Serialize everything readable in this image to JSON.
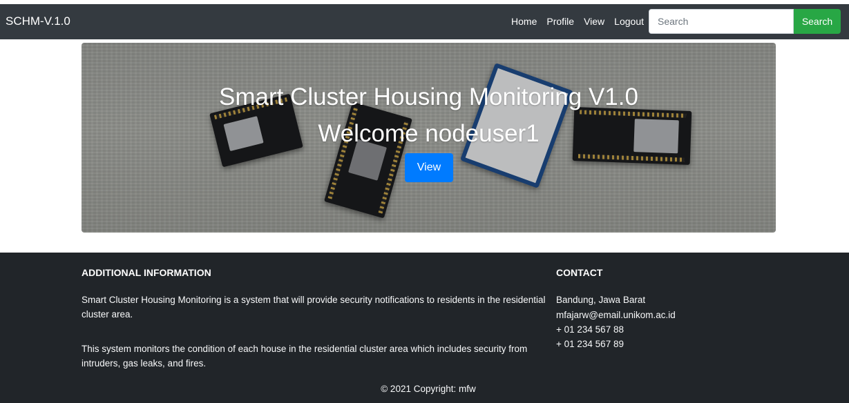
{
  "navbar": {
    "brand": "SCHM-V.1.0",
    "links": [
      "Home",
      "Profile",
      "View",
      "Logout"
    ],
    "search_placeholder": "Search",
    "search_button": "Search",
    "background": "#343a40",
    "search_button_color": "#28a745"
  },
  "hero": {
    "title": "Smart Cluster Housing Monitoring V1.0",
    "welcome": "Welcome nodeuser1",
    "button_label": "View",
    "button_color": "#007bff"
  },
  "footer": {
    "additional_heading": "ADDITIONAL INFORMATION",
    "paragraph_1": "Smart Cluster Housing Monitoring is a system that will provide security notifications to residents in the residential cluster area.",
    "paragraph_2": "This system monitors the condition of each house in the residential cluster area which includes security from intruders, gas leaks, and fires.",
    "contact_heading": "CONTACT",
    "contact": {
      "location": "Bandung, Jawa Barat",
      "email": "mfajarw@email.unikom.ac.id",
      "phone_1": "+ 01 234 567 88",
      "phone_2": "+ 01 234 567 89"
    },
    "copyright": "© 2021 Copyright: mfw",
    "background": "#212529"
  }
}
